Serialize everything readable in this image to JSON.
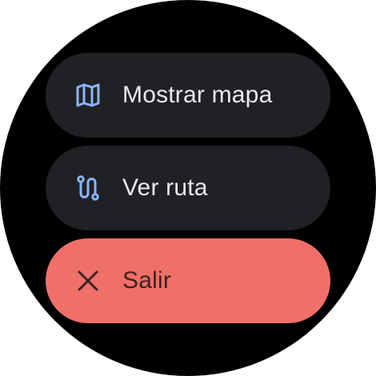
{
  "menu": {
    "items": [
      {
        "id": "show-map",
        "label": "Mostrar mapa",
        "icon": "map-icon",
        "icon_color": "#8ab4f8",
        "background": "#202124"
      },
      {
        "id": "view-route",
        "label": "Ver ruta",
        "icon": "route-icon",
        "icon_color": "#8ab4f8",
        "background": "#202124"
      },
      {
        "id": "exit",
        "label": "Salir",
        "icon": "close-icon",
        "icon_color": "#3c2220",
        "background": "#f07068"
      }
    ]
  },
  "colors": {
    "screen_background": "#000000",
    "item_background": "#202124",
    "accent_blue": "#8ab4f8",
    "exit_background": "#f07068",
    "text_light": "#e8eaed"
  }
}
